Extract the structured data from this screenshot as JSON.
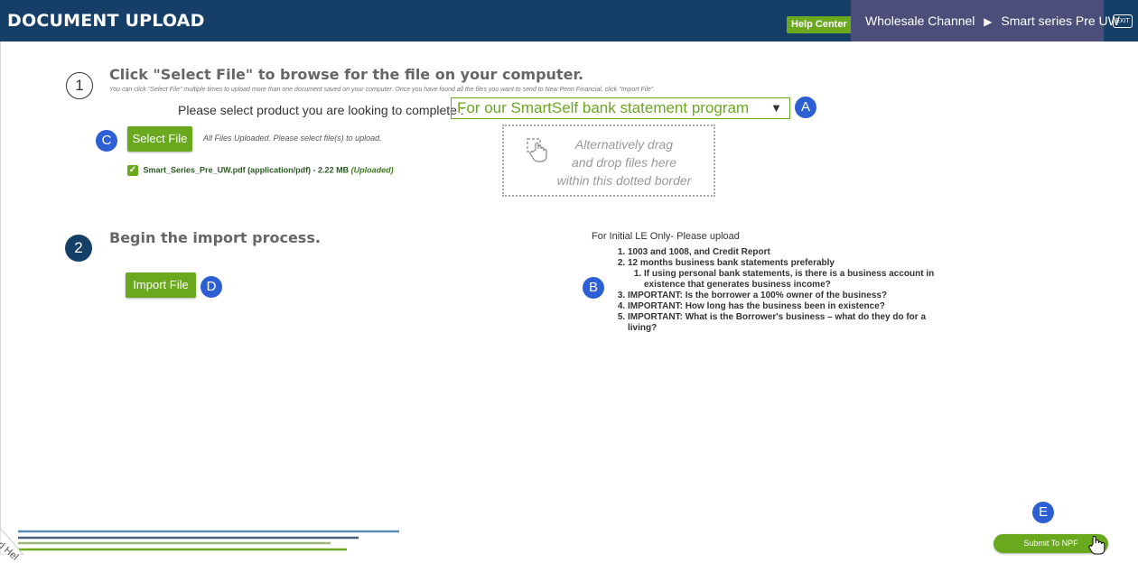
{
  "header": {
    "title": "DOCUMENT UPLOAD",
    "help_label": "Help Center",
    "channel": "Wholesale Channel",
    "channel_sep": "▶",
    "channel_sub": "Smart series Pre UW",
    "exit_label": "EXIT"
  },
  "step1": {
    "number": "1",
    "title": "Click \"Select File\" to browse for the file on your computer.",
    "note": "You can click \"Select File\" multiple times to upload more than one document saved on your computer. Once you have found all the files you want to send to New Penn Financial, click \"Import File\".",
    "product_label": "Please select product you are looking to complete :",
    "product_value": "For our SmartSelf bank statement program",
    "select_label": "Select File",
    "status_note": "All Files Uploaded. Please select file(s) to upload.",
    "file_name": "Smart_Series_Pre_UW.pdf (application/pdf) - 2.22 MB",
    "file_status": "(Uploaded)",
    "drop_line1": "Alternatively drag",
    "drop_line2": "and drop files here",
    "drop_line3": "within this dotted border"
  },
  "step2": {
    "number": "2",
    "title": "Begin the import process.",
    "import_label": "Import File"
  },
  "info": {
    "title": "For Initial LE Only- Please upload",
    "items": [
      "1003 and 1008, and Credit Report",
      "12 months business bank statements preferably",
      "IMPORTANT: Is the borrower a 100% owner of the business?",
      "IMPORTANT: How long has the business been in existence?",
      "IMPORTANT: What is the Borrower's business – what do they do for a living?"
    ],
    "subitem": "If using personal bank statements, is there is a business account in existence that generates business income?"
  },
  "markers": {
    "a": "A",
    "b": "B",
    "c": "C",
    "d": "D",
    "e": "E"
  },
  "submit_label": "Submit To NPF",
  "corner_text": "ed Hel",
  "colors": {
    "header": "#163f67",
    "channel": "#4a4e79",
    "green": "#6aa81e",
    "marker": "#2c5fd4"
  }
}
